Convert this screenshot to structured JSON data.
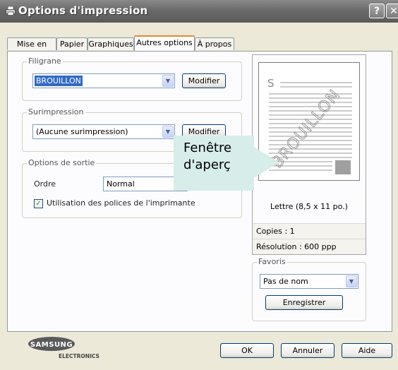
{
  "window": {
    "title": "Options d'impression",
    "help_label": "?",
    "close_label": "✕"
  },
  "tabs": [
    {
      "label": "Mise en page",
      "active": false
    },
    {
      "label": "Papier",
      "active": false
    },
    {
      "label": "Graphiques",
      "active": false
    },
    {
      "label": "Autres options",
      "active": true
    },
    {
      "label": "À propos",
      "active": false
    }
  ],
  "filigrane": {
    "title": "Filigrane",
    "value": "BROUILLON",
    "button": "Modifier"
  },
  "surimpression": {
    "title": "Surimpression",
    "value": "(Aucune surimpression)",
    "button": "Modifier"
  },
  "sortie": {
    "title": "Options de sortie",
    "ordre_label": "Ordre",
    "ordre_value": "Normal",
    "polices_label": "Utilisation des polices de l'imprimante",
    "polices_checked": true
  },
  "preview": {
    "page_letter": "S",
    "watermark": "BROUILLON",
    "paper_size": "Lettre (8,5 x 11 po.)",
    "copies": "Copies : 1",
    "resolution": "Résolution : 600 ppp"
  },
  "favoris": {
    "title": "Favoris",
    "value": "Pas de nom",
    "button": "Enregistrer"
  },
  "logo": {
    "brand": "SAMSUNG",
    "sub": "ELECTRONICS"
  },
  "footer": {
    "ok": "OK",
    "cancel": "Annuler",
    "help": "Aide"
  },
  "callout": {
    "line1": "Fenêtre",
    "line2": "d'aperç"
  },
  "icons": {
    "dropdown": "chevron-down-icon",
    "check": "checkmark-icon",
    "printer": "printer-icon"
  }
}
